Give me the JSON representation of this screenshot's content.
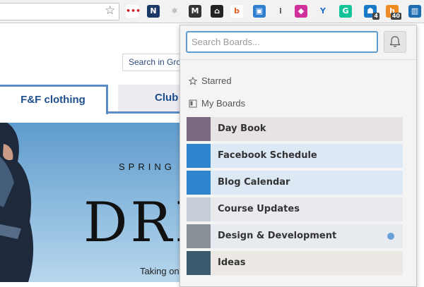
{
  "browser": {
    "extensions": [
      {
        "name": "lastpass-icon",
        "glyph": "•••",
        "bg": "#ffffff",
        "fg": "#d32020"
      },
      {
        "name": "n-extension-icon",
        "glyph": "N",
        "bg": "#1b3966",
        "fg": "#ffffff"
      },
      {
        "name": "react-devtools-icon",
        "glyph": "⚛",
        "bg": "#f2f2f2",
        "fg": "#666666"
      },
      {
        "name": "mailchimp-icon",
        "glyph": "M",
        "bg": "#333333",
        "fg": "#ffffff"
      },
      {
        "name": "owl-icon",
        "glyph": "⌂",
        "bg": "#222222",
        "fg": "#ffffff"
      },
      {
        "name": "b-extension-icon",
        "glyph": "b",
        "bg": "#ffffff",
        "fg": "#e05b1c"
      },
      {
        "name": "screen-capture-icon",
        "glyph": "▣",
        "bg": "#2f7fd1",
        "fg": "#ffffff"
      },
      {
        "name": "sound-bars-icon",
        "glyph": "⁞",
        "bg": "#f2f2f2",
        "fg": "#333333"
      },
      {
        "name": "tag-icon",
        "glyph": "◆",
        "bg": "#d0309a",
        "fg": "#ffffff"
      },
      {
        "name": "yoast-icon",
        "glyph": "Y",
        "bg": "#f2f2f2",
        "fg": "#1f6ec9"
      },
      {
        "name": "grammarly-icon",
        "glyph": "G",
        "bg": "#15c39a",
        "fg": "#ffffff"
      },
      {
        "name": "ghostery-icon",
        "glyph": "☗",
        "bg": "#1a79c6",
        "fg": "#ffffff",
        "badge": "4"
      },
      {
        "name": "honey-icon",
        "glyph": "h",
        "bg": "#f08a24",
        "fg": "#ffffff",
        "badge": "40"
      },
      {
        "name": "trello-icon",
        "glyph": "▥",
        "bg": "#1d6db3",
        "fg": "#ffffff"
      }
    ]
  },
  "page": {
    "search_label": "Search in Gro",
    "tabs": [
      "F&F clothing",
      "Club"
    ],
    "hero": {
      "spring": "SPRING",
      "headline": "DRE",
      "tagline": "Taking on"
    }
  },
  "popup": {
    "search_placeholder": "Search Boards...",
    "sections": {
      "starred": "Starred",
      "my_boards": "My Boards"
    },
    "boards": [
      {
        "name": "Day Book",
        "thumb": "#7a6a82",
        "bg": "#e7e3e3"
      },
      {
        "name": "Facebook Schedule",
        "thumb": "#2f86cf",
        "bg": "#dce8f4"
      },
      {
        "name": "Blog Calendar",
        "thumb": "#2f86cf",
        "bg": "#dce8f4"
      },
      {
        "name": "Course Updates",
        "thumb": "#c5cdd8",
        "bg": "#e8eaee"
      },
      {
        "name": "Design & Development",
        "thumb": "#8a9097",
        "bg": "#e7eaee",
        "dot": true
      },
      {
        "name": "Ideas",
        "thumb": "#3a5b6e",
        "bg": "#ece9e4"
      }
    ],
    "accent": "#5f9bcc"
  }
}
